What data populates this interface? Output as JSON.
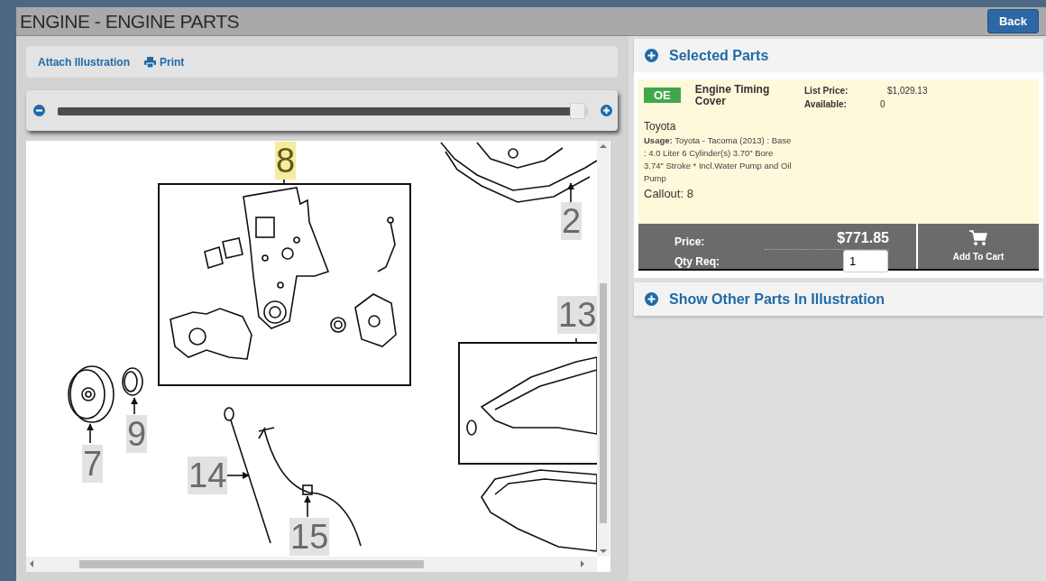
{
  "header": {
    "title": "ENGINE - ENGINE PARTS",
    "back_button": "Back"
  },
  "toolbar": {
    "attach_link": "Attach Illustration",
    "print_link": "Print"
  },
  "zoom": {
    "level": 0.97
  },
  "illustration": {
    "callouts": [
      {
        "label": "8",
        "selected": true
      },
      {
        "label": "2",
        "selected": false
      },
      {
        "label": "13",
        "selected": false
      },
      {
        "label": "9",
        "selected": false
      },
      {
        "label": "7",
        "selected": false
      },
      {
        "label": "14",
        "selected": false
      },
      {
        "label": "15",
        "selected": false
      }
    ]
  },
  "selected_parts": {
    "heading": "Selected Parts",
    "part": {
      "badge": "OE",
      "name": "Engine Timing Cover",
      "list_price_label": "List Price:",
      "list_price": "$1,029.13",
      "available_label": "Available:",
      "available": "0",
      "brand": "Toyota",
      "usage": "**Usage:** Toyota - Tacoma (2013) : Base : 4.0 Liter 6 Cylinder(s) 3.70\" Bore 3.74\" Stroke * Incl.Water Pump and Oil Pump",
      "callout": "Callout: 8",
      "price_label": "Price:",
      "price": "$771.85",
      "qty_label": "Qty Req:",
      "qty": "1",
      "add_to_cart": "Add To Cart"
    }
  },
  "other_parts": {
    "heading": "Show Other Parts In Illustration"
  }
}
